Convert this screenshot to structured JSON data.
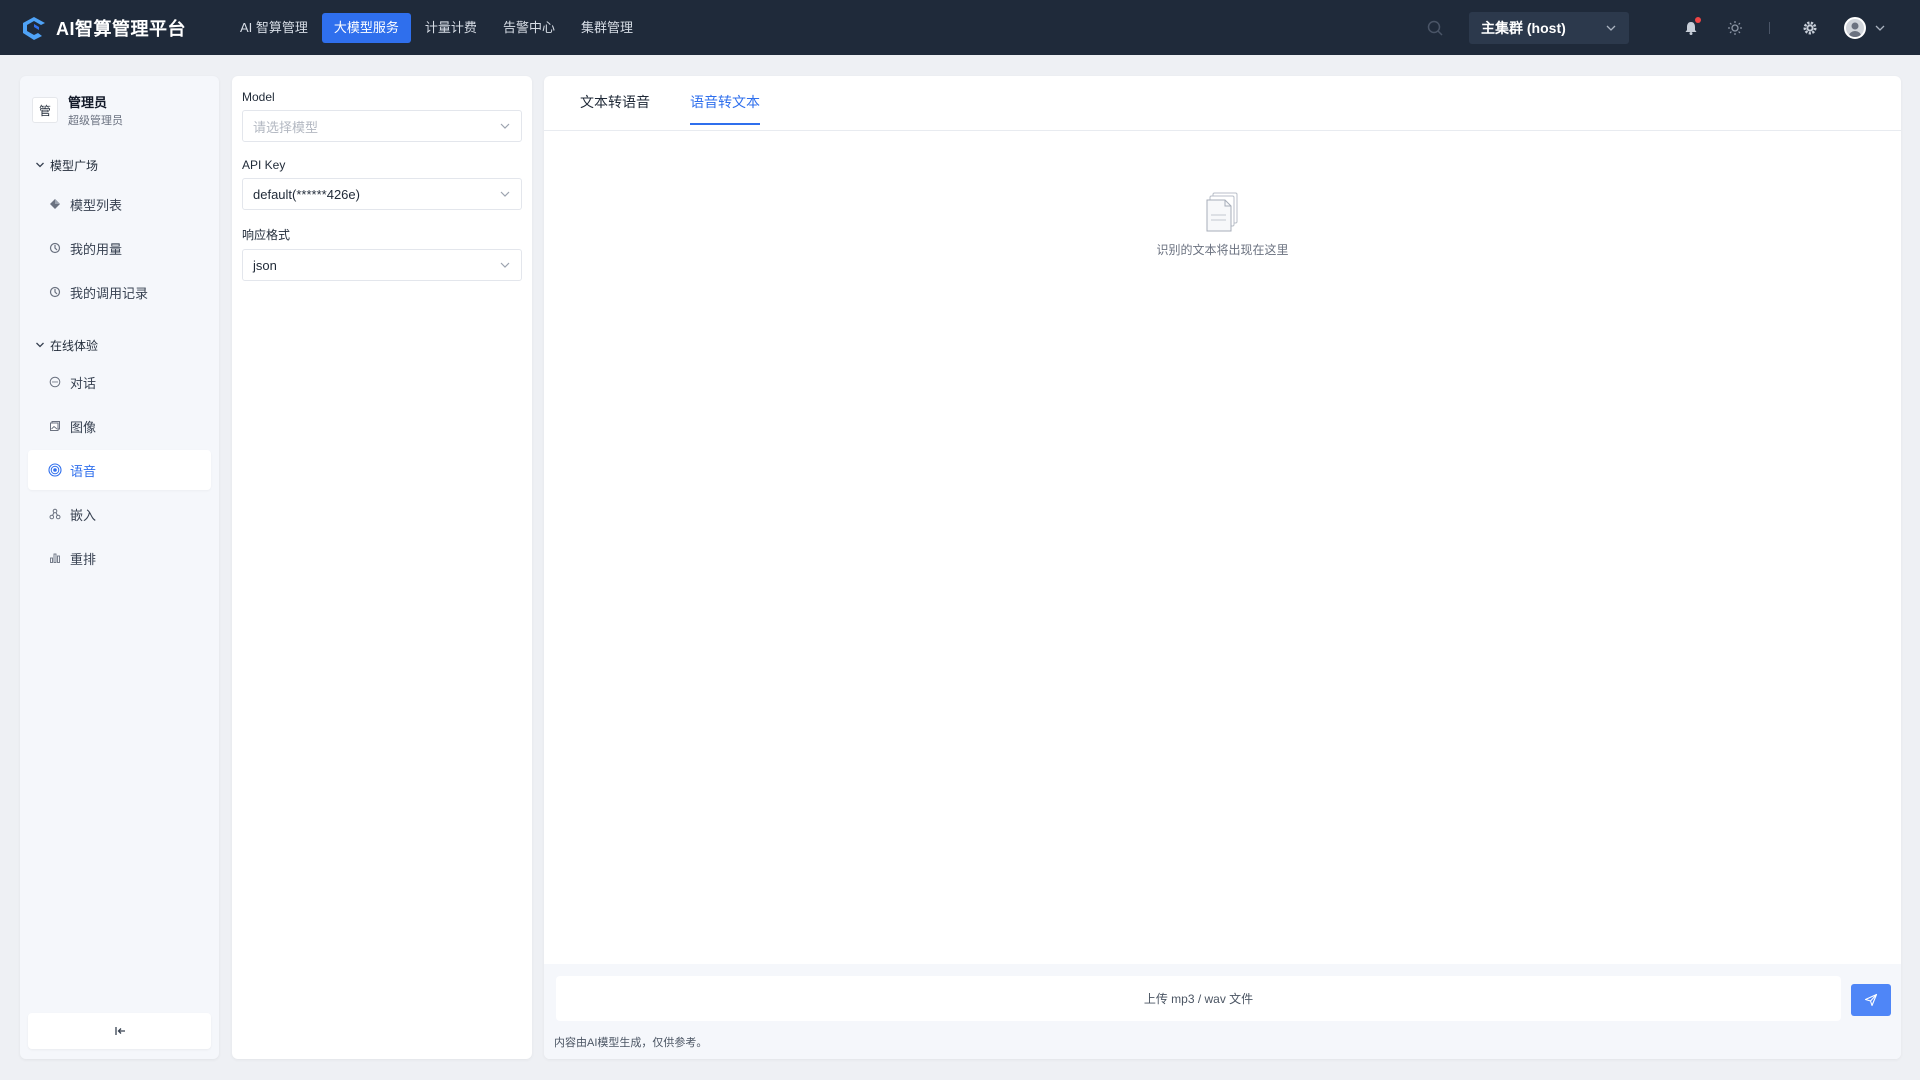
{
  "app": {
    "title": "AI智算管理平台",
    "brand_color": "#2f6fed",
    "logo_icon": "platform-logo-icon"
  },
  "topnav": {
    "items": [
      {
        "label": "AI 智算管理",
        "active": false
      },
      {
        "label": "大模型服务",
        "active": true
      },
      {
        "label": "计量计费",
        "active": false
      },
      {
        "label": "告警中心",
        "active": false
      },
      {
        "label": "集群管理",
        "active": false
      }
    ],
    "cluster_select": "主集群 (host)",
    "icons": [
      "search-icon",
      "bell-icon",
      "sun-icon",
      "gear-icon",
      "avatar-icon",
      "chevron-down-icon"
    ]
  },
  "sidebar": {
    "user": {
      "badge": "管",
      "name": "管理员",
      "role": "超级管理员"
    },
    "groups": [
      {
        "title": "模型广场",
        "items": [
          {
            "label": "模型列表",
            "icon": "cube-icon"
          },
          {
            "label": "我的用量",
            "icon": "usage-icon"
          },
          {
            "label": "我的调用记录",
            "icon": "record-icon"
          }
        ]
      },
      {
        "title": "在线体验",
        "items": [
          {
            "label": "对话",
            "icon": "chat-icon"
          },
          {
            "label": "图像",
            "icon": "image-icon"
          },
          {
            "label": "语音",
            "icon": "audio-icon",
            "active": true
          },
          {
            "label": "嵌入",
            "icon": "embed-icon"
          },
          {
            "label": "重排",
            "icon": "rerank-icon"
          }
        ]
      }
    ],
    "collapse_icon": "collapse-icon"
  },
  "config": {
    "model_label": "Model",
    "model_placeholder": "请选择模型",
    "apikey_label": "API Key",
    "apikey_value": "default(******426e)",
    "format_label": "响应格式",
    "format_value": "json"
  },
  "main": {
    "tabs": [
      {
        "label": "文本转语音",
        "active": false
      },
      {
        "label": "语音转文本",
        "active": true
      }
    ],
    "empty_text": "识别的文本将出现在这里",
    "upload_text": "上传 mp3 / wav 文件",
    "disclaimer": "内容由AI模型生成，仅供参考。"
  }
}
